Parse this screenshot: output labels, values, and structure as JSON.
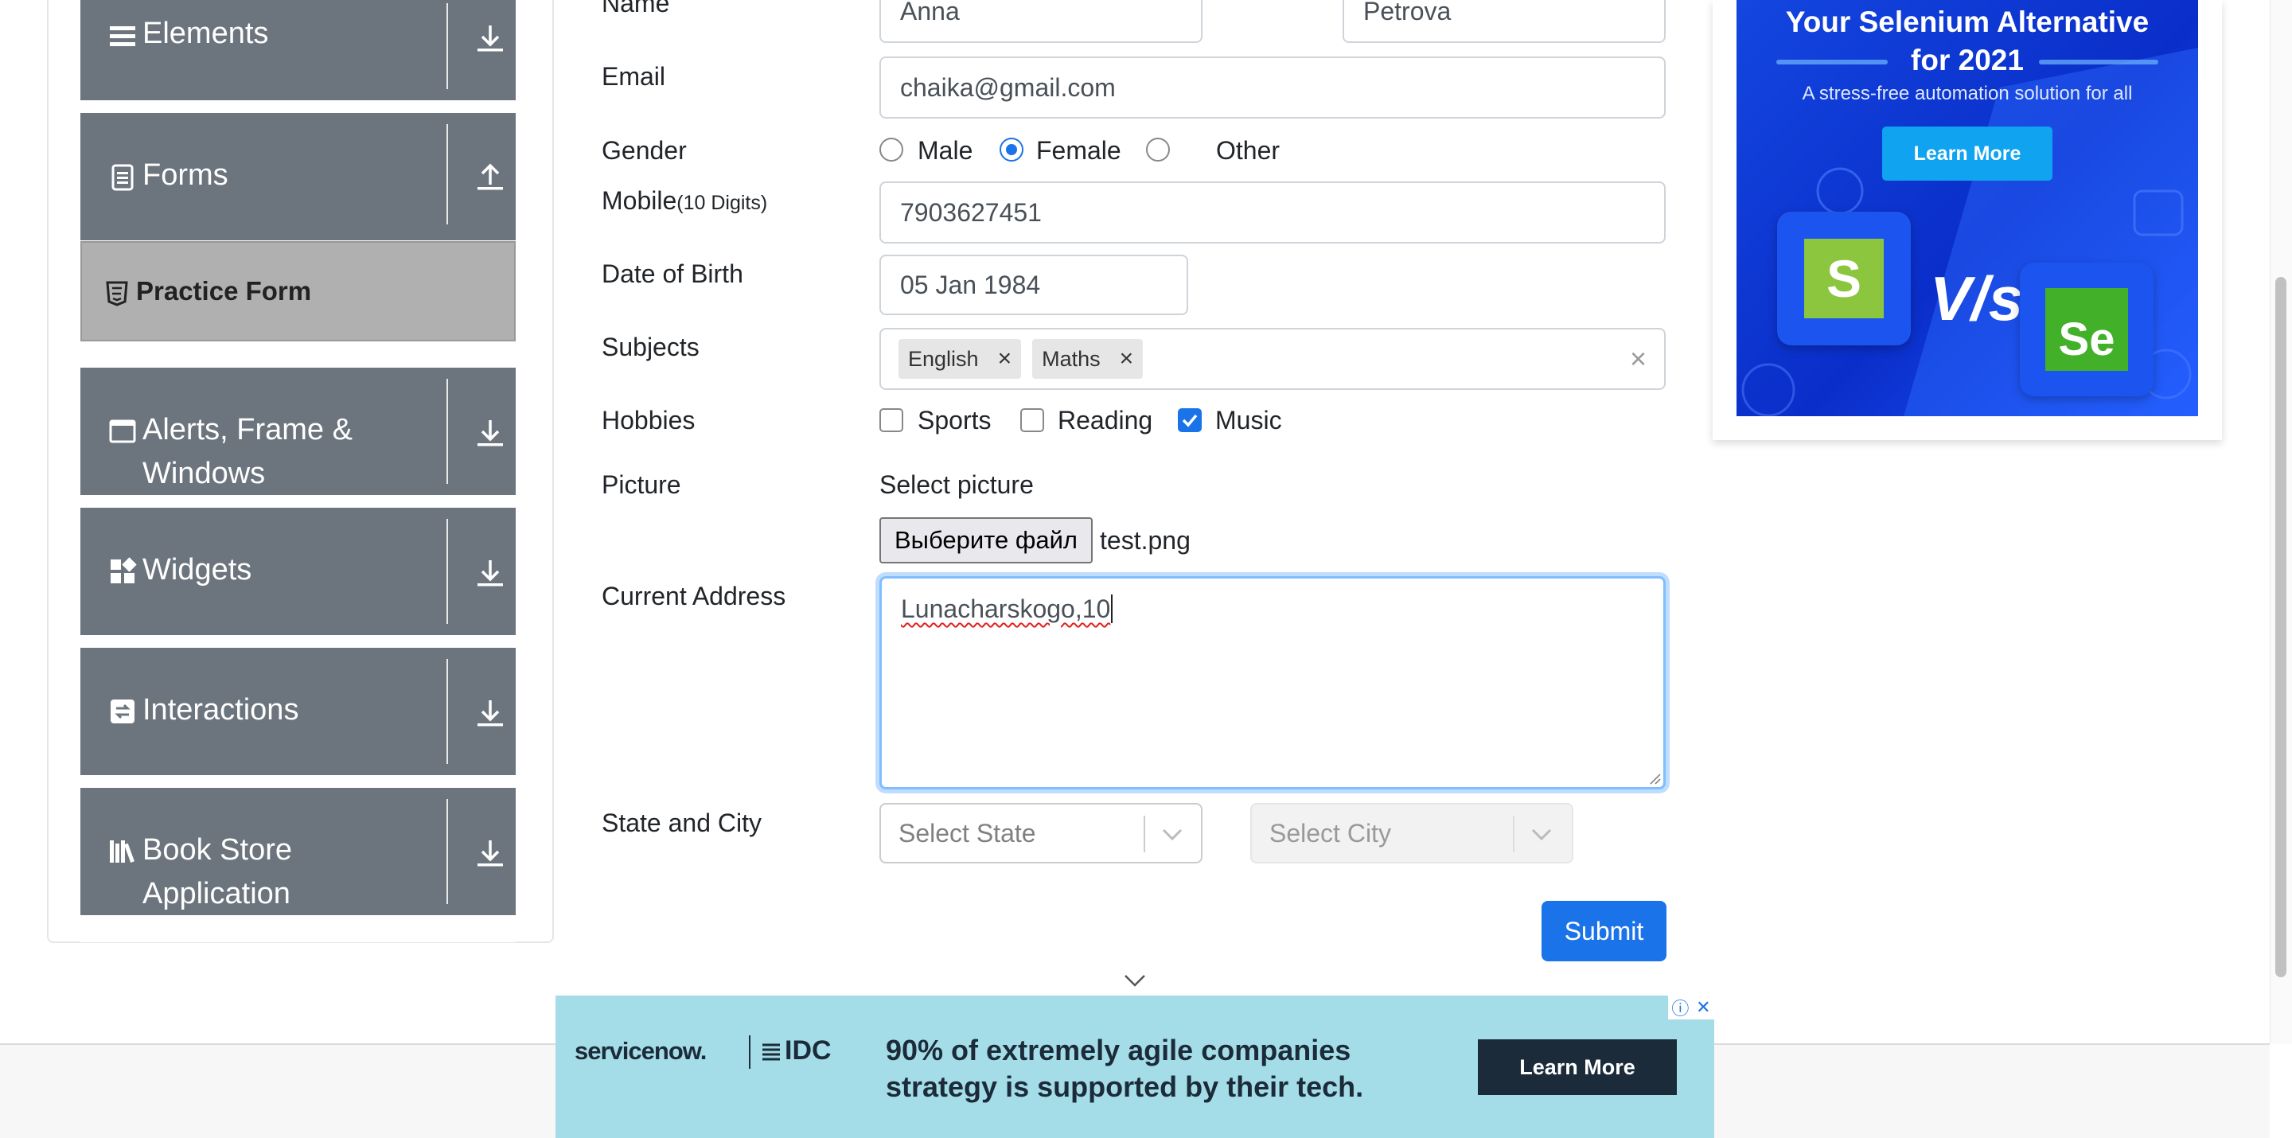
{
  "sidebar": {
    "groups": [
      {
        "label": "Elements",
        "icon": "list-icon",
        "arrow": "download-arrow-icon"
      },
      {
        "label": "Forms",
        "icon": "document-icon",
        "arrow": "upload-arrow-icon"
      },
      {
        "label": "Alerts, Frame &",
        "label2": "Windows",
        "icon": "window-icon",
        "arrow": "download-arrow-icon"
      },
      {
        "label": "Widgets",
        "icon": "widgets-icon",
        "arrow": "download-arrow-icon"
      },
      {
        "label": "Interactions",
        "icon": "interactions-icon",
        "arrow": "download-arrow-icon"
      },
      {
        "label": "Book Store",
        "label2": "Application",
        "icon": "books-icon",
        "arrow": "download-arrow-icon"
      }
    ],
    "active_item": {
      "label": "Practice Form",
      "icon": "html5-icon"
    }
  },
  "form": {
    "name_label": "Name",
    "first_name": "Anna",
    "last_name": "Petrova",
    "email_label": "Email",
    "email": "chaika@gmail.com",
    "gender_label": "Gender",
    "genders": [
      "Male",
      "Female",
      "Other"
    ],
    "gender_selected": "Female",
    "mobile_label": "Mobile",
    "mobile_hint": "(10 Digits)",
    "mobile": "7903627451",
    "dob_label": "Date of Birth",
    "dob": "05 Jan 1984",
    "subjects_label": "Subjects",
    "subjects": [
      "English",
      "Maths"
    ],
    "chip_remove": "×",
    "subjects_clear": "×",
    "hobbies_label": "Hobbies",
    "hobbies": [
      "Sports",
      "Reading",
      "Music"
    ],
    "hobbies_checked": [
      "Music"
    ],
    "picture_label": "Picture",
    "picture_prompt": "Select picture",
    "file_button": "Выберите файл",
    "file_name": "test.png",
    "address_label": "Current Address",
    "address": "Lunacharskogo,10",
    "state_city_label": "State and City",
    "state_placeholder": "Select State",
    "city_placeholder": "Select City",
    "submit": "Submit"
  },
  "ad_right": {
    "title_line1": "Your Selenium Alternative",
    "title_line2": "for 2021",
    "subtitle": "A stress-free automation solution for all",
    "button": "Learn More",
    "logo_left": "S",
    "vs": "V/s",
    "logo_right": "Se"
  },
  "ad_bottom": {
    "brand1": "servicenow.",
    "brand2": "IDC",
    "text_line1": "90% of extremely agile companies",
    "text_line2": "strategy is supported by their tech.",
    "button": "Learn More",
    "info_icon": "ⓘ",
    "close_icon": "✕"
  },
  "colors": {
    "sidebar_group": "#6c757d",
    "active_item": "#b0b0b0",
    "primary": "#1a73e8",
    "ad_right_bg": "#0a2ec9",
    "ad_bottom_bg": "#a4dde8"
  }
}
